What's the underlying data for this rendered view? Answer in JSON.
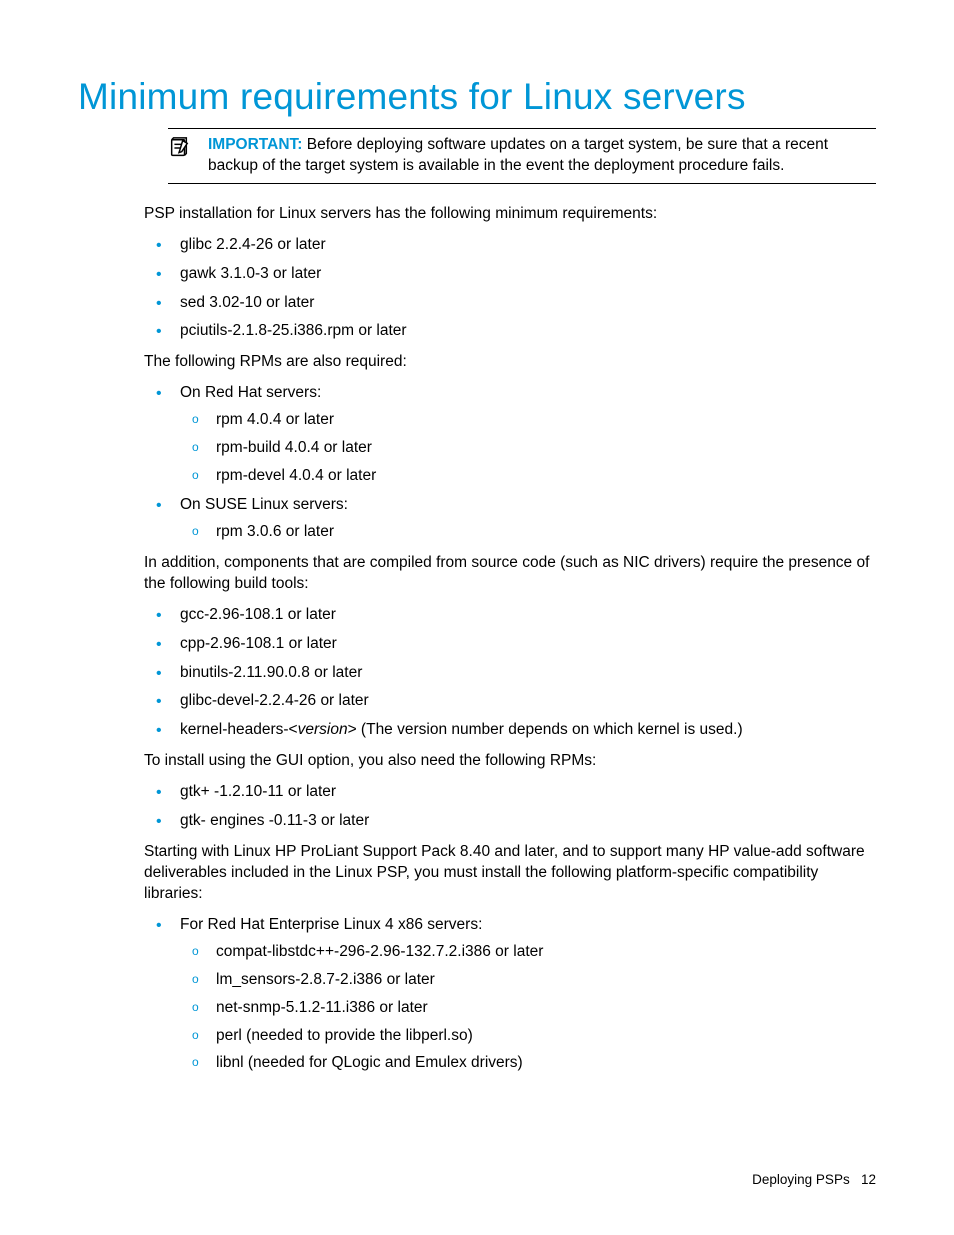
{
  "heading": "Minimum requirements for Linux servers",
  "callout": {
    "label": "IMPORTANT:",
    "text": "Before deploying software updates on a target system, be sure that a recent backup of the target system is available in the event the deployment procedure fails."
  },
  "intro": "PSP installation for Linux servers has the following minimum requirements:",
  "req_basic": [
    "glibc 2.2.4-26 or later",
    "gawk 3.1.0-3 or later",
    "sed 3.02-10 or later",
    "pciutils-2.1.8-25.i386.rpm or later"
  ],
  "rpm_intro": "The following RPMs are also required:",
  "rpm_sections": [
    {
      "title": "On Red Hat servers:",
      "items": [
        "rpm 4.0.4 or later",
        "rpm-build 4.0.4 or later",
        "rpm-devel 4.0.4 or later"
      ]
    },
    {
      "title": "On SUSE Linux servers:",
      "items": [
        "rpm 3.0.6 or later"
      ]
    }
  ],
  "build_intro": "In addition, components that are compiled from source code (such as NIC drivers) require the presence of the following build tools:",
  "build_tools": [
    "gcc-2.96-108.1 or later",
    "cpp-2.96-108.1 or later",
    "binutils-2.11.90.0.8 or later",
    "glibc-devel-2.2.4-26 or later"
  ],
  "kernel_headers_pre": "kernel-headers-<",
  "kernel_headers_mid": "version",
  "kernel_headers_post": "> (The version number depends on which kernel is used.)",
  "gui_intro": "To install using the GUI option, you also need the following RPMs:",
  "gui_rpms": [
    "gtk+ -1.2.10-11 or later",
    "gtk- engines -0.11-3 or later"
  ],
  "compat_intro": "Starting with Linux HP ProLiant Support Pack 8.40 and later, and to support many HP value-add software deliverables included in the Linux PSP, you must install the following platform-specific compatibility libraries:",
  "compat_sections": [
    {
      "title": "For Red Hat Enterprise Linux 4 x86 servers:",
      "items": [
        "compat-libstdc++-296-2.96-132.7.2.i386 or later",
        "lm_sensors-2.8.7-2.i386 or later",
        "net-snmp-5.1.2-11.i386 or later",
        "perl (needed to provide the libperl.so)",
        "libnl (needed for QLogic and Emulex drivers)"
      ]
    }
  ],
  "footer": {
    "section": "Deploying PSPs",
    "page": "12"
  }
}
